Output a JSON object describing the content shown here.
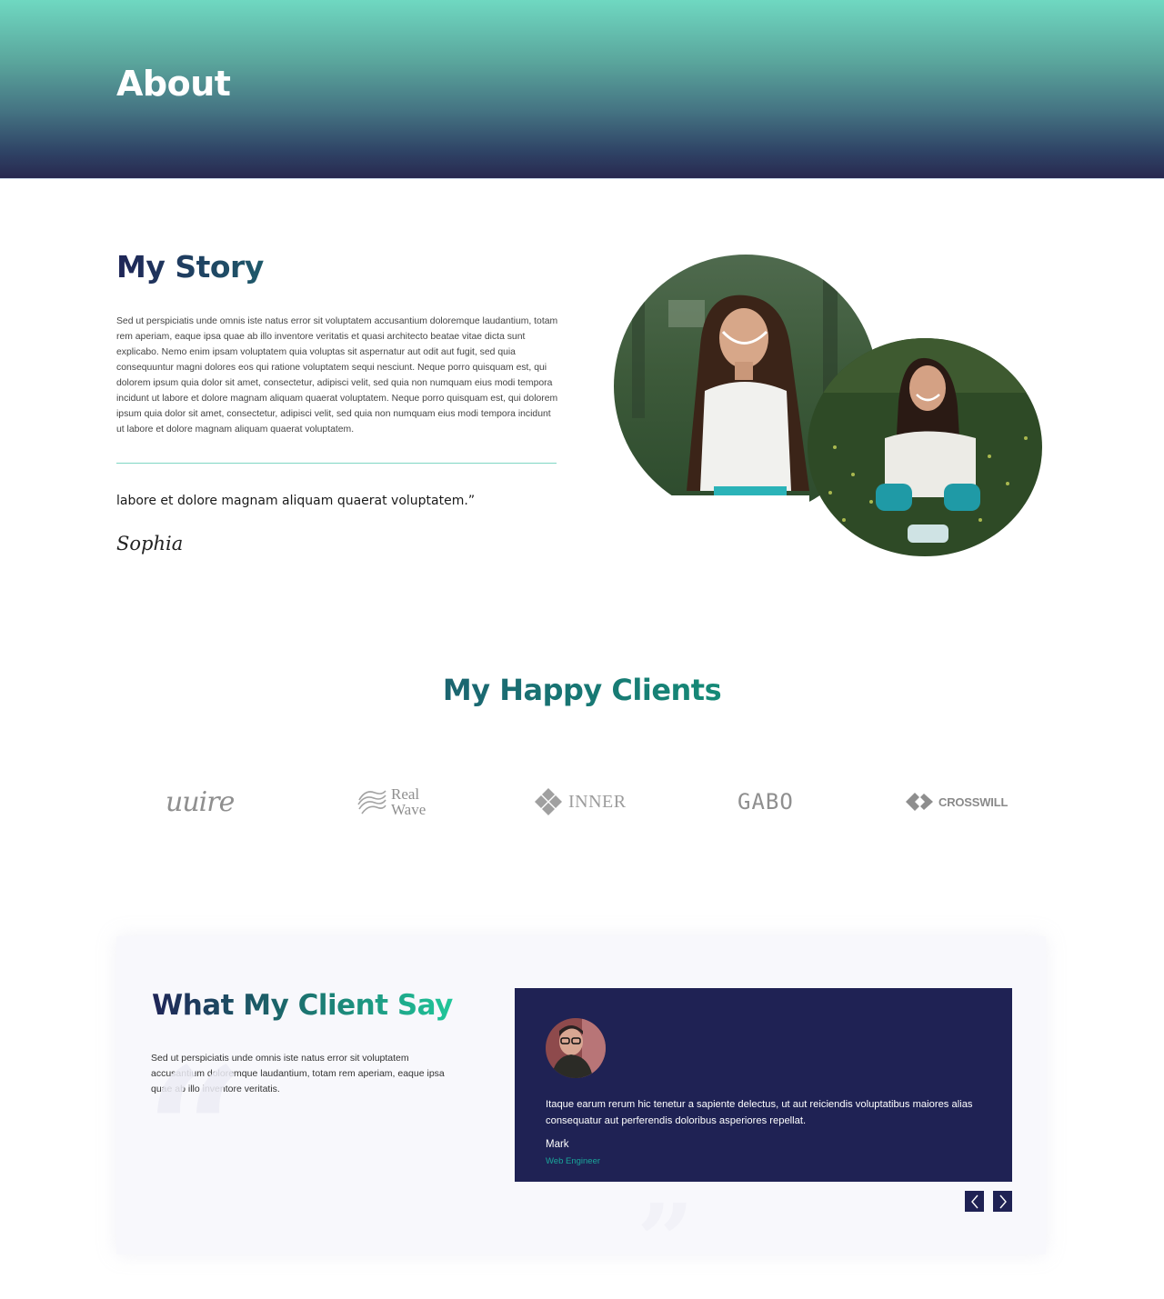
{
  "hero": {
    "title": "About",
    "gradient": [
      "#6fd8c1",
      "#28284f"
    ]
  },
  "story": {
    "title": "My Story",
    "paragraph": "Sed ut perspiciatis unde omnis iste natus error sit voluptatem accusantium doloremque laudantium, totam rem aperiam, eaque ipsa quae ab illo inventore veritatis et quasi architecto beatae vitae dicta sunt explicabo. Nemo enim ipsam voluptatem quia voluptas sit aspernatur aut odit aut fugit, sed quia consequuntur magni dolores eos qui ratione voluptatem sequi nesciunt. Neque porro quisquam est, qui dolorem ipsum quia dolor sit amet, consectetur, adipisci velit, sed quia non numquam eius modi tempora incidunt ut labore et dolore magnam aliquam quaerat voluptatem. Neque porro quisquam est, qui dolorem ipsum quia dolor sit amet, consectetur, adipisci velit, sed quia non numquam eius modi tempora incidunt ut labore et dolore magnam aliquam quaerat voluptatem.",
    "quote_visible_line": "labore et dolore magnam aliquam quaerat voluptatem.”",
    "signature": "Sophia",
    "images": [
      {
        "alt": "Smiling woman with long hair in a park"
      },
      {
        "alt": "Smiling woman sitting on grass wearing knee pads"
      }
    ],
    "accent_color": "#7fd6c4"
  },
  "clients": {
    "title": "My Happy Clients",
    "logos": [
      {
        "name": "wiire",
        "text": "uuire"
      },
      {
        "name": "realwave",
        "text_line1": "Real",
        "text_line2": "Wave"
      },
      {
        "name": "inner",
        "text": "INNER"
      },
      {
        "name": "gabo",
        "text": "GABO"
      },
      {
        "name": "crosswill",
        "text": "CROSSWILL"
      }
    ]
  },
  "testimonials": {
    "title": "What My Client Say",
    "intro": "Sed ut perspiciatis unde omnis iste natus error sit voluptatem accusantium doloremque laudantium, totam rem aperiam, eaque ipsa quae ab illo inventore veritatis.",
    "quote_glyph_open": "“",
    "quote_glyph_close": "”",
    "active": {
      "text": "Itaque earum rerum hic tenetur a sapiente delectus, ut aut reiciendis voluptatibus maiores alias consequatur aut perferendis doloribus asperiores repellat.",
      "name": "Mark",
      "role": "Web Engineer"
    },
    "nav": {
      "prev_icon": "chevron-left-icon",
      "next_icon": "chevron-right-icon"
    },
    "card_color": "#1f2254",
    "role_color": "#1aa59a"
  }
}
